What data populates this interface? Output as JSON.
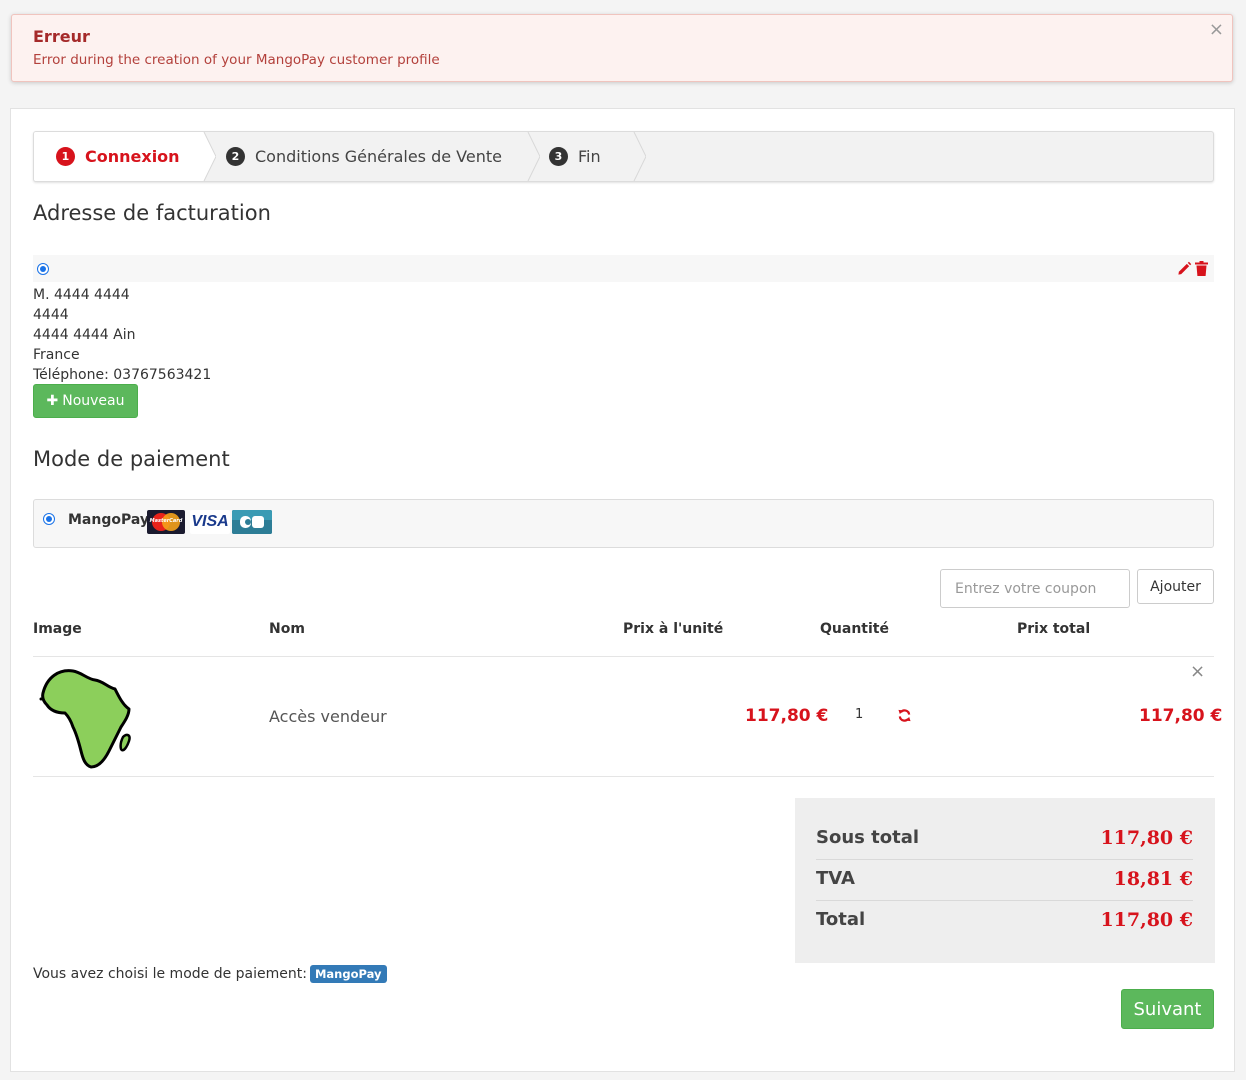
{
  "alert": {
    "title": "Erreur",
    "message": "Error during the creation of your MangoPay customer profile",
    "close": "×"
  },
  "steps": [
    {
      "number": "1",
      "label": "Connexion",
      "active": true
    },
    {
      "number": "2",
      "label": "Conditions Générales de Vente",
      "active": false
    },
    {
      "number": "3",
      "label": "Fin",
      "active": false
    }
  ],
  "billing": {
    "heading": "Adresse de facturation",
    "address_lines": [
      "M. 4444 4444",
      "4444",
      "4444 4444 Ain",
      "France",
      "Téléphone: 03767563421"
    ],
    "new_button": "Nouveau"
  },
  "payment": {
    "heading": "Mode de paiement",
    "method": "MangoPay",
    "card_logos": [
      "mastercard-logo",
      "visa-logo",
      "cb-logo"
    ],
    "mastercard_text": "MasterCard",
    "visa_text": "VISA"
  },
  "coupon": {
    "placeholder": "Entrez votre coupon",
    "add_button": "Ajouter"
  },
  "table": {
    "headers": [
      "Image",
      "Nom",
      "Prix à l'unité",
      "Quantité",
      "Prix total"
    ],
    "rows": [
      {
        "image": "africa-map-icon",
        "name": "Accès vendeur",
        "unit_price": "117,80 €",
        "quantity": "1",
        "total": "117,80 €"
      }
    ],
    "remove": "×"
  },
  "totals": [
    {
      "label": "Sous total",
      "value": "117,80 €"
    },
    {
      "label": "TVA",
      "value": "18,81 €"
    },
    {
      "label": "Total",
      "value": "117,80 €"
    }
  ],
  "chosen": {
    "text": "Vous avez choisi le mode de paiement:",
    "badge": "MangoPay"
  },
  "next_button": "Suivant",
  "colors": {
    "accent_red": "#d7131c",
    "green": "#5cb85c",
    "badge_blue": "#337ab7"
  }
}
